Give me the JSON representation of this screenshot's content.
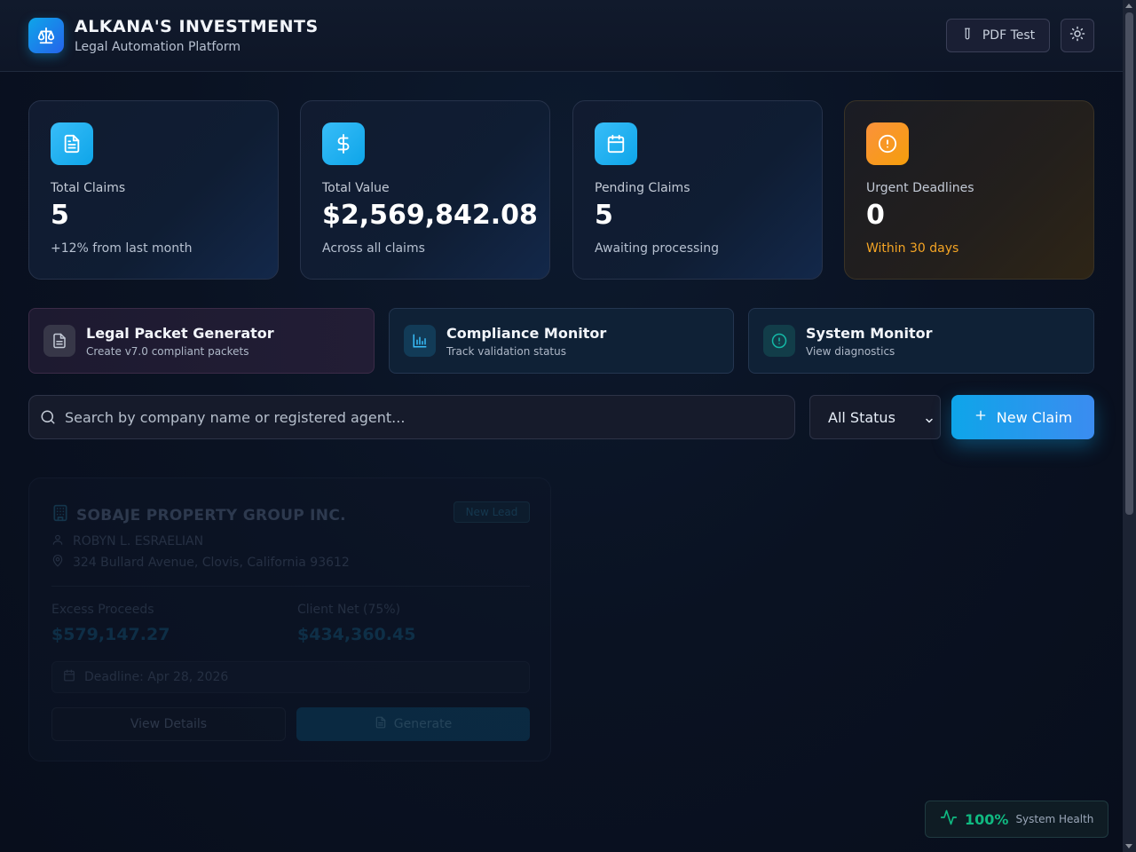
{
  "header": {
    "title": "ALKANA'S INVESTMENTS",
    "subtitle": "Legal Automation Platform",
    "pdf_test_label": "PDF Test"
  },
  "stats": [
    {
      "label": "Total Claims",
      "value": "5",
      "note": "+12% from last month",
      "icon": "document-icon"
    },
    {
      "label": "Total Value",
      "value": "$2,569,842.08",
      "note": "Across all claims",
      "icon": "dollar-icon"
    },
    {
      "label": "Pending Claims",
      "value": "5",
      "note": "Awaiting processing",
      "icon": "calendar-icon"
    },
    {
      "label": "Urgent Deadlines",
      "value": "0",
      "note": "Within 30 days",
      "icon": "alert-icon"
    }
  ],
  "tools": [
    {
      "title": "Legal Packet Generator",
      "subtitle": "Create v7.0 compliant packets"
    },
    {
      "title": "Compliance Monitor",
      "subtitle": "Track validation status"
    },
    {
      "title": "System Monitor",
      "subtitle": "View diagnostics"
    }
  ],
  "search": {
    "placeholder": "Search by company name or registered agent..."
  },
  "filter": {
    "selected": "All Status"
  },
  "new_claim_label": "New Claim",
  "claim": {
    "company": "SOBAJE PROPERTY GROUP INC.",
    "status_badge": "New Lead",
    "agent": "ROBYN L. ESRAELIAN",
    "address": "324 Bullard Avenue, Clovis, California 93612",
    "excess_label": "Excess Proceeds",
    "excess_value": "$579,147.27",
    "net_label": "Client Net (75%)",
    "net_value": "$434,360.45",
    "deadline": "Deadline: Apr 28, 2026",
    "view_label": "View Details",
    "generate_label": "Generate"
  },
  "health": {
    "percent": "100%",
    "label": "System Health"
  },
  "colors": {
    "accent": "#0ea5e9",
    "warning": "#f59e0b",
    "success": "#10b981"
  }
}
